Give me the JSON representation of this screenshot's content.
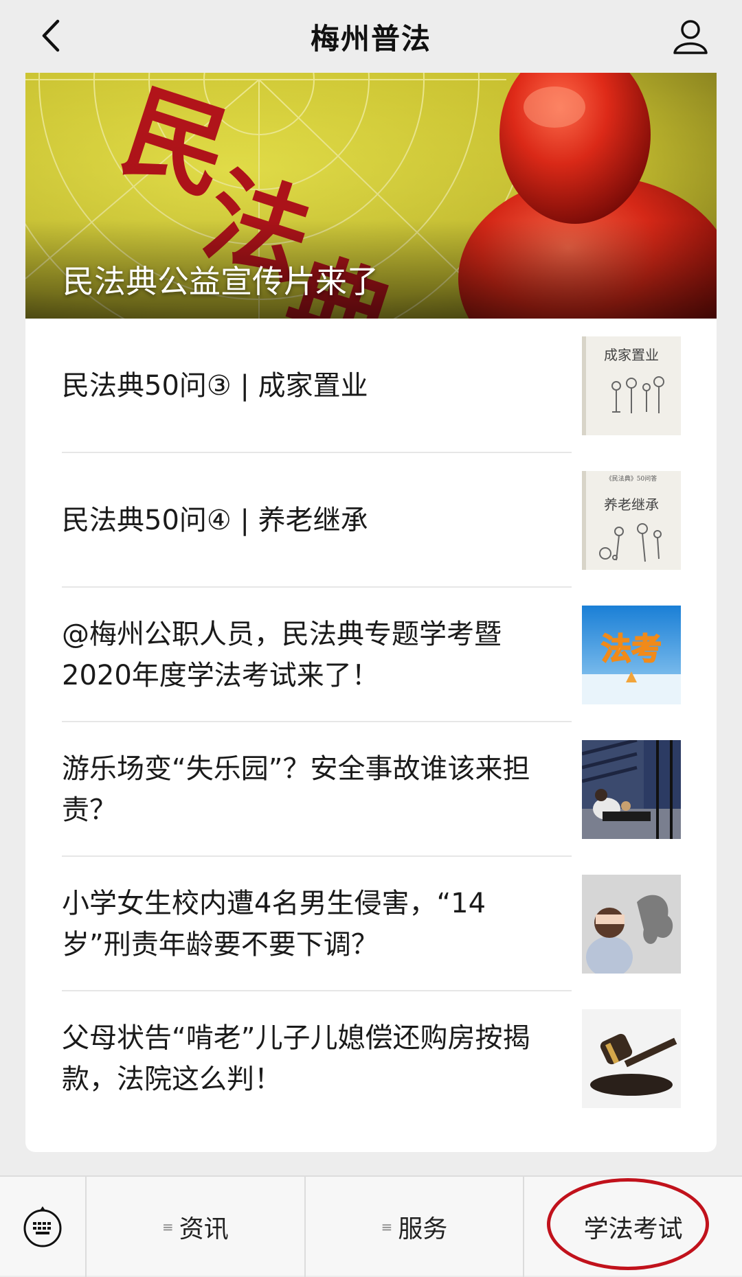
{
  "header": {
    "title": "梅州普法",
    "back_icon": "chevron-left-icon",
    "profile_icon": "user-icon"
  },
  "banner": {
    "title": "民法典公益宣传片来了",
    "image_text": "民法典"
  },
  "articles": [
    {
      "title": "民法典50问③ | 成家置业",
      "thumb_label": "成家置业"
    },
    {
      "title": "民法典50问④ | 养老继承",
      "thumb_top": "《民法典》50问答",
      "thumb_label": "养老继承"
    },
    {
      "title": "@梅州公职人员，民法典专题学考暨2020年度学法考试来了！",
      "thumb_label": "法考"
    },
    {
      "title": "游乐场变“失乐园”？安全事故谁该来担责？"
    },
    {
      "title": "小学女生校内遭4名男生侵害，“14岁”刑责年龄要不要下调？"
    },
    {
      "title": "父母状告“啃老”儿子儿媳偿还购房按揭款，法院这么判！"
    }
  ],
  "bottom_menu": {
    "keyboard_icon": "keyboard-icon",
    "items": [
      {
        "label": "资讯"
      },
      {
        "label": "服务"
      },
      {
        "label": "学法考试"
      }
    ]
  },
  "colors": {
    "highlight_circle": "#c1121c",
    "banner_bg": "#d9d23a"
  }
}
